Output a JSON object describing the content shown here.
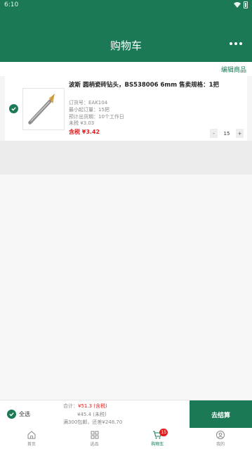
{
  "status_bar": {
    "time": "6:10"
  },
  "header": {
    "title": "购物车"
  },
  "edit_bar": {
    "edit_label": "编辑商品"
  },
  "cart_item": {
    "title": "波斯 圆柄瓷砖钻头，BS538006 6mm 售卖规格：1把",
    "meta": [
      "订货号：EAK104",
      "最小起订量：15把",
      "预计出货期：10个工作日",
      "未税 ¥3.03"
    ],
    "price_with_tax": "含税 ¥3.42",
    "quantity": "15",
    "minus_label": "-",
    "plus_label": "+"
  },
  "bottom_bar": {
    "select_all_label": "全选",
    "total_prefix": "合计：",
    "total_tax": "¥51.3 (含税)",
    "total_untaxed": "¥45.4 (未税)",
    "free_shipping_note": "满300包邮，还差¥248.70",
    "checkout_label": "去结算"
  },
  "tabbar": {
    "tabs": [
      {
        "label": "首页",
        "icon": "home-icon"
      },
      {
        "label": "选品",
        "icon": "grid-icon"
      },
      {
        "label": "购物车",
        "icon": "cart-icon",
        "badge": "15"
      },
      {
        "label": "我的",
        "icon": "user-icon"
      }
    ]
  },
  "colors": {
    "brand": "#1b7a55",
    "price": "#e02020"
  }
}
